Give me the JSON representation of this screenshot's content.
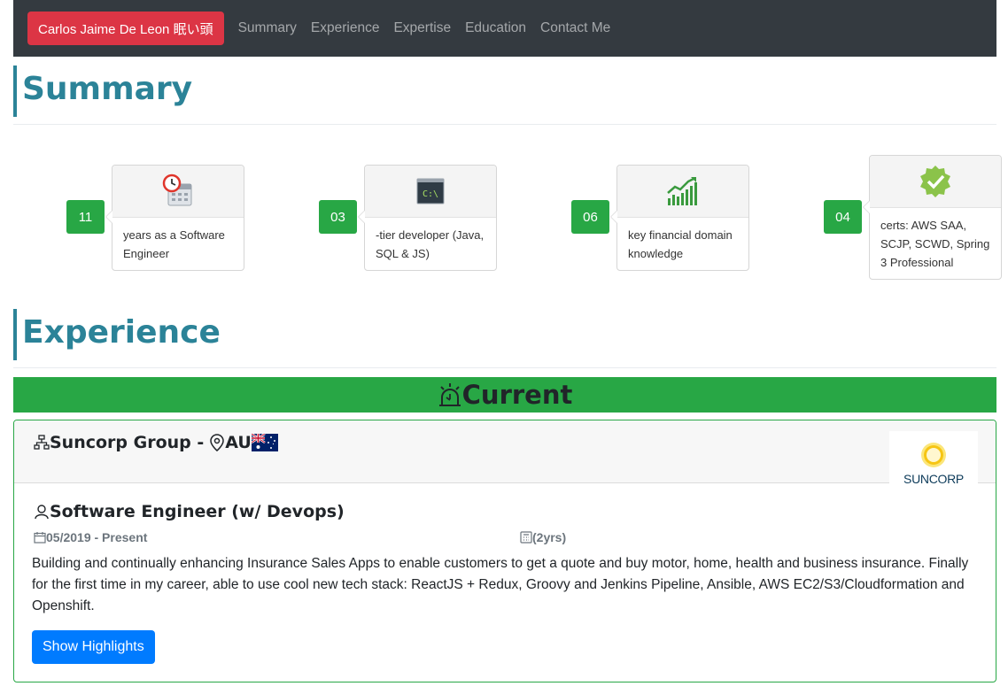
{
  "navbar": {
    "brand": "Carlos Jaime De Leon 眠い頭",
    "links": [
      "Summary",
      "Experience",
      "Expertise",
      "Education",
      "Contact Me"
    ]
  },
  "summary": {
    "title": "Summary",
    "stats": [
      {
        "number": "11",
        "text": "years as a Software Engineer",
        "icon": "calendar-clock-icon"
      },
      {
        "number": "03",
        "text": "-tier developer (Java, SQL & JS)",
        "icon": "terminal-icon"
      },
      {
        "number": "06",
        "text": "key financial domain knowledge",
        "icon": "growth-chart-icon"
      },
      {
        "number": "04",
        "text": "certs: AWS SAA, SCJP, SCWD, Spring 3 Professional",
        "icon": "verified-badge-icon"
      }
    ]
  },
  "experience": {
    "title": "Experience",
    "current_label": "Current",
    "job": {
      "company": "Suncorp Group - ",
      "location": "AU",
      "logo_text": "SUNCORP",
      "role": "Software Engineer (w/ Devops)",
      "dates": "05/2019 - Present",
      "duration": "(2yrs)",
      "description": "Building and continually enhancing Insurance Sales Apps to enable customers to get a quote and buy motor, home, health and business insurance. Finally for the first time in my career, able to use cool new tech stack: ReactJS + Redux, Groovy and Jenkins Pipeline, Ansible, AWS EC2/S3/Cloudformation and Openshift.",
      "button_label": "Show Highlights"
    }
  },
  "colors": {
    "navbar": "#343a40",
    "brand": "#dc3545",
    "heading": "#2b8398",
    "success": "#28a745",
    "primary": "#007bff"
  }
}
